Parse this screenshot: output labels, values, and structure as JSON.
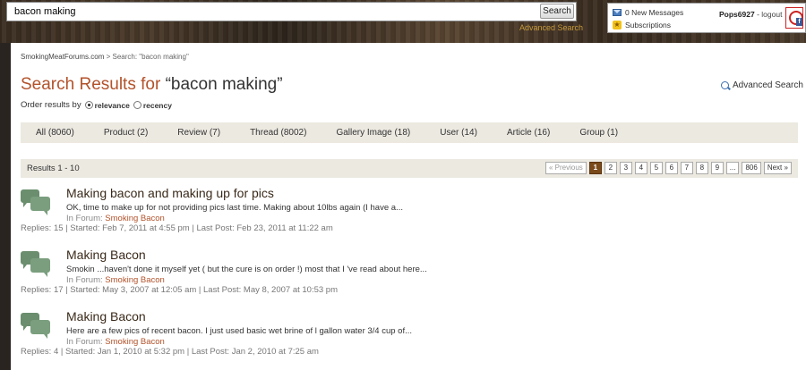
{
  "header": {
    "search_value": "bacon making",
    "search_button": "Search",
    "advanced_search": "Advanced Search"
  },
  "userbox": {
    "messages": "0 New Messages",
    "subscriptions": "Subscriptions",
    "username": "Pops6927",
    "separator": " - ",
    "logout": "logout"
  },
  "breadcrumb": {
    "home": "SmokingMeatForums.com",
    "sep": ">",
    "current": "Search: \"bacon making\""
  },
  "title": {
    "prefix": "Search Results for",
    "query": "“bacon making”"
  },
  "advanced_search_link": "Advanced Search",
  "order": {
    "label": "Order results by",
    "option1": "relevance",
    "option2": "recency",
    "selected": "relevance"
  },
  "tabs": [
    "All (8060)",
    "Product (2)",
    "Review (7)",
    "Thread (8002)",
    "Gallery Image (18)",
    "User (14)",
    "Article (16)",
    "Group (1)"
  ],
  "results_bar": {
    "count": "Results 1 - 10",
    "prev": "« Previous",
    "pages": [
      "1",
      "2",
      "3",
      "4",
      "5",
      "6",
      "7",
      "8",
      "9",
      "...",
      "806"
    ],
    "current_page": "1",
    "next": "Next »"
  },
  "results": [
    {
      "title": "Making bacon and making up for pics",
      "snippet": "OK, time to make up for not providing pics last time.  Making about 10lbs again (I have a...",
      "forum_label": "In Forum:",
      "forum": "Smoking Bacon",
      "meta": "Replies: 15   |  Started: Feb 7, 2011 at 4:55 pm  |  Last Post: Feb 23, 2011 at 11:22 am"
    },
    {
      "title": "Making Bacon",
      "snippet": "Smokin ...haven't done it myself yet ( but the cure is on order !) most that I 've read about here...",
      "forum_label": "In Forum:",
      "forum": "Smoking Bacon",
      "meta": "Replies: 17   |  Started: May 3, 2007 at 12:05 am  |  Last Post: May 8, 2007 at 10:53 pm"
    },
    {
      "title": "Making Bacon",
      "snippet": "Here are a few pics of recent bacon. I just used basic wet brine of l gallon water 3/4 cup of...",
      "forum_label": "In Forum:",
      "forum": "Smoking Bacon",
      "meta": "Replies: 4   |  Started: Jan 1, 2010 at 5:32 pm  |  Last Post: Jan 2, 2010 at 7:25 am"
    }
  ]
}
